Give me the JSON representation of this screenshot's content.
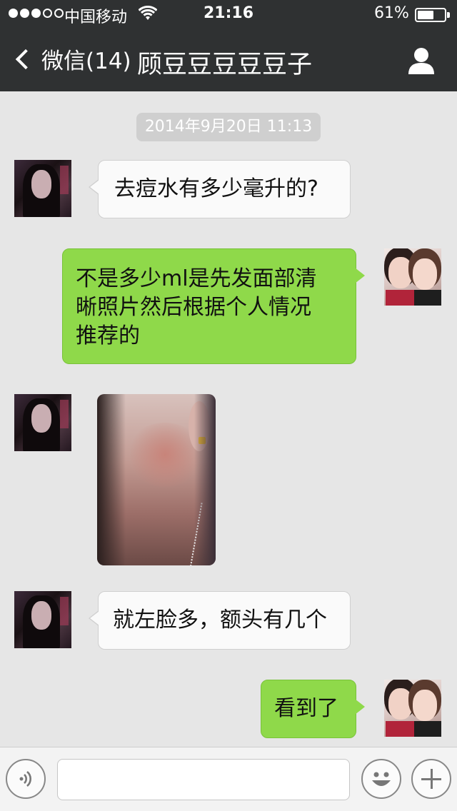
{
  "status_bar": {
    "carrier": "中国移动",
    "time": "21:16",
    "battery": "61%",
    "battery_level": 0.61,
    "signal_bars_filled": 3,
    "signal_bars_total": 5
  },
  "nav": {
    "back_label": "微信(14)",
    "title": "顾豆豆豆豆豆子"
  },
  "timestamp": "2014年9月20日 11:13",
  "messages": [
    {
      "side": "in",
      "text": "去痘水有多少毫升的?"
    },
    {
      "side": "out",
      "lines": [
        "不是多少ml是先发面部清",
        "晰照片然后根据个人情况",
        "推荐的"
      ]
    },
    {
      "side": "in",
      "type": "image"
    },
    {
      "side": "in",
      "text": "就左脸多，额头有几个"
    },
    {
      "side": "out",
      "text": "看到了"
    }
  ],
  "input_bar": {
    "placeholder": ""
  },
  "colors": {
    "nav_bg": "#2f3132",
    "chat_bg": "#e6e6e6",
    "outgoing_bubble": "#8fd94a",
    "incoming_bubble": "#fafafa"
  }
}
